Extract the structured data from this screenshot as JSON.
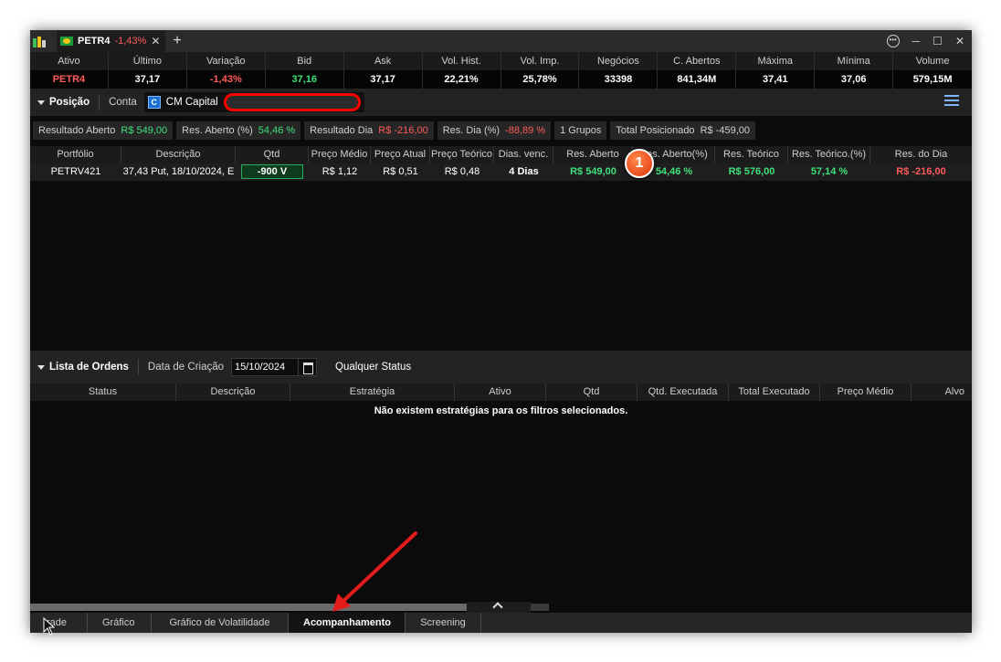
{
  "tab": {
    "symbol": "PETR4",
    "change": "-1,43%"
  },
  "quote": {
    "headers": [
      "Ativo",
      "Último",
      "Variação",
      "Bid",
      "Ask",
      "Vol. Hist.",
      "Vol. Imp.",
      "Negócios",
      "C. Abertos",
      "Máxima",
      "Mínima",
      "Volume"
    ],
    "values": [
      "PETR4",
      "37,17",
      "-1,43%",
      "37,16",
      "37,17",
      "22,21%",
      "25,78%",
      "33398",
      "841,34M",
      "37,41",
      "37,06",
      "579,15M"
    ]
  },
  "position": {
    "title": "Posição",
    "conta_label": "Conta",
    "account_name": "CM Capital",
    "account_icon": "C"
  },
  "summary": [
    {
      "label": "Resultado Aberto",
      "value": "R$ 549,00",
      "tone": "pos"
    },
    {
      "label": "Res. Aberto (%)",
      "value": "54,46 %",
      "tone": "pos"
    },
    {
      "label": "Resultado Dia",
      "value": "R$ -216,00",
      "tone": "neg"
    },
    {
      "label": "Res. Dia (%)",
      "value": "-88,89 %",
      "tone": "neg"
    },
    {
      "label": "1 Grupos",
      "value": "",
      "tone": ""
    },
    {
      "label": "Total Posicionado",
      "value": "R$ -459,00",
      "tone": ""
    }
  ],
  "ptable": {
    "headers": [
      "Portfólio",
      "Descrição",
      "Qtd",
      "Preço Médio",
      "Preço Atual",
      "Preço Teórico",
      "Dias. venc.",
      "Res. Aberto",
      "Res. Aberto(%)",
      "Res. Teórico",
      "Res. Teórico.(%)",
      "Res. do Dia"
    ],
    "row": [
      "PETRV421",
      "37,43 Put, 18/10/2024, E",
      "-900 V",
      "R$ 1,12",
      "R$ 0,51",
      "R$ 0,48",
      "4 Dias",
      "R$ 549,00",
      "54,46 %",
      "R$ 576,00",
      "57,14 %",
      "R$ -216,00"
    ]
  },
  "badge": "1",
  "orders": {
    "title": "Lista de Ordens",
    "date_label": "Data de Criação",
    "date_value": "15/10/2024",
    "status_label": "Qualquer Status",
    "headers": [
      "Status",
      "Descrição",
      "Estratégia",
      "Ativo",
      "Qtd",
      "Qtd. Executada",
      "Total Executado",
      "Preço Médio",
      "Alvo"
    ],
    "empty_message": "Não existem estratégias para os filtros selecionados."
  },
  "bottom_tabs": [
    "Trade",
    "Gráfico",
    "Gráfico de Volatilidade",
    "Acompanhamento",
    "Screening"
  ],
  "bottom_tab_display": [
    "rade",
    "Gráfico",
    "Gráfico de Volatilidade",
    "Acompanhamento",
    "Screening"
  ],
  "active_tab": "Acompanhamento",
  "colors": {
    "positive": "#3fe07a",
    "negative": "#ff5a5a",
    "annotation": "#e0320a",
    "arrow": "#e31b1b"
  }
}
